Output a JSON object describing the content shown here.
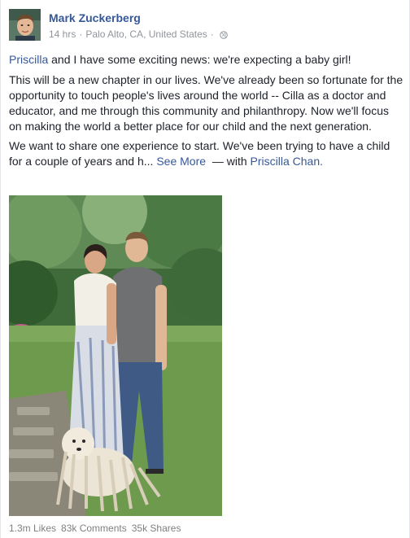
{
  "post": {
    "author": "Mark Zuckerberg",
    "time": "14 hrs",
    "location": "Palo Alto, CA, United States",
    "meta_separator": "·",
    "privacy_icon": "globe-icon",
    "paragraph1_link": "Priscilla",
    "paragraph1_rest": " and I have some exciting news: we're expecting a baby girl!",
    "paragraph2": "This will be a new chapter in our lives. We've already been so fortunate for the opportunity to touch people's lives around the world -- Cilla as a doctor and educator, and me through this community and philanthropy. Now we'll focus on making the world a better place for our child and the next generation.",
    "paragraph3": "We want to share one experience to start. We've been trying to have a child for a couple of years and h...",
    "see_more": "See More",
    "with_text": "— with",
    "tagged": "Priscilla Chan",
    "tagged_suffix": "."
  },
  "stats": {
    "likes": "1.3m Likes",
    "comments": "83k Comments",
    "shares": "35k Shares"
  },
  "colors": {
    "link": "#365899",
    "text": "#1d2129",
    "meta": "#90949c"
  }
}
